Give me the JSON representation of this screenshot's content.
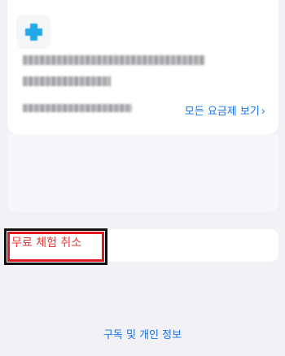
{
  "subscription": {
    "all_plans_label": "모든 요금제 보기",
    "all_plans_chevron": "›",
    "icon": "app-plus-icon"
  },
  "actions": {
    "cancel_trial_label": "무료 체험 취소"
  },
  "footer": {
    "privacy_label": "구독 및 개인 정보"
  },
  "colors": {
    "background": "#f2f2f6",
    "link": "#1a73e8",
    "destructive": "#e53935",
    "highlight_outline": "#e0181f"
  }
}
